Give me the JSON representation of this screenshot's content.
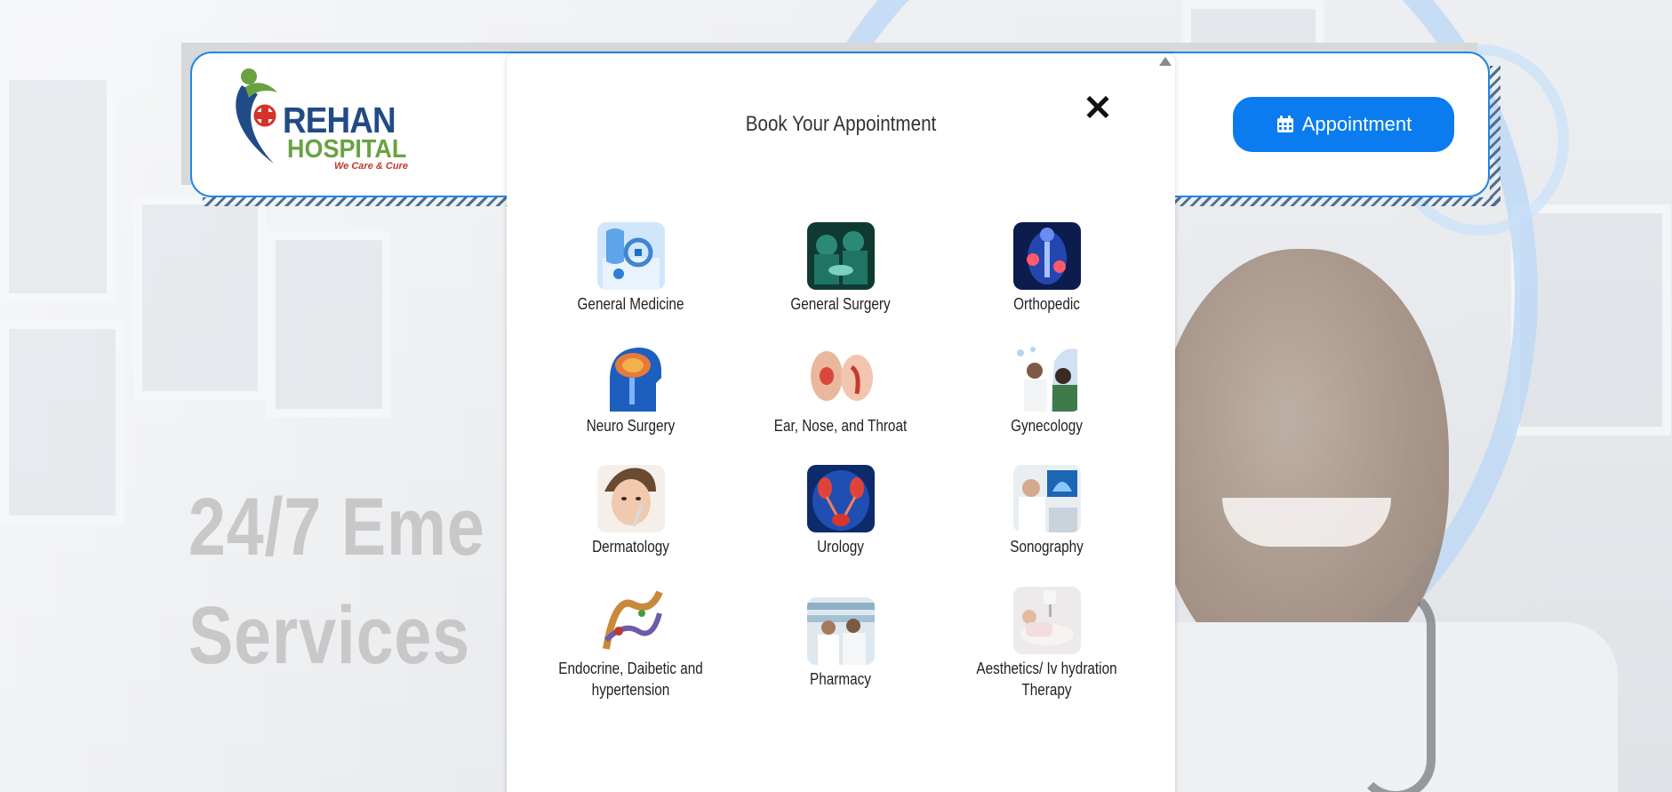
{
  "brand": {
    "name": "REHAN",
    "sub": "HOSPITAL",
    "tagline": "We Care & Cure"
  },
  "header": {
    "appointment_label": "Appointment",
    "appointment_icon": "calendar-icon"
  },
  "hero": {
    "line1": "24/7 Eme",
    "line2": "Services"
  },
  "modal": {
    "title": "Book Your Appointment",
    "close_glyph": "✕",
    "departments": [
      {
        "label": "General Medicine",
        "icon": "general-medicine-icon"
      },
      {
        "label": "General Surgery",
        "icon": "general-surgery-icon"
      },
      {
        "label": "Orthopedic",
        "icon": "orthopedic-icon"
      },
      {
        "label": "Neuro Surgery",
        "icon": "neuro-surgery-icon"
      },
      {
        "label": "Ear, Nose, and Throat",
        "icon": "ent-icon"
      },
      {
        "label": "Gynecology",
        "icon": "gynecology-icon"
      },
      {
        "label": "Dermatology",
        "icon": "dermatology-icon"
      },
      {
        "label": "Urology",
        "icon": "urology-icon"
      },
      {
        "label": "Sonography",
        "icon": "sonography-icon"
      },
      {
        "label": "Endocrine, Daibetic and hypertension",
        "icon": "endocrine-icon"
      },
      {
        "label": "Pharmacy",
        "icon": "pharmacy-icon"
      },
      {
        "label": "Aesthetics/ Iv hydration Therapy",
        "icon": "aesthetics-icon"
      }
    ]
  },
  "colors": {
    "accent": "#0a7cf0",
    "brand_blue": "#214b87",
    "brand_green": "#6aa241",
    "brand_red": "#c0392b"
  }
}
